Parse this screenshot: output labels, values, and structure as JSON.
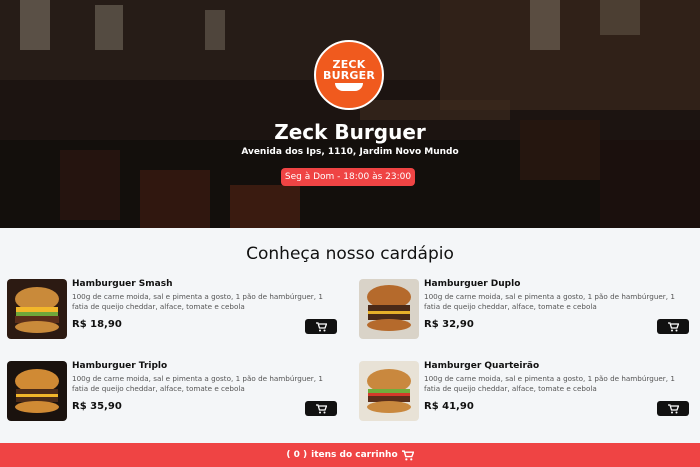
{
  "header": {
    "logo_line1": "ZECK",
    "logo_line2": "BURGER",
    "title": "Zeck Burguer",
    "address": "Avenida dos Ips, 1110, Jardim Novo Mundo",
    "hours": "Seg à Dom - 18:00 às 23:00"
  },
  "menu": {
    "section_title": "Conheça nosso cardápio",
    "items": [
      {
        "name": "Hamburguer Smash",
        "description": "100g de carne moida, sal e pimenta a gosto, 1 pão de hambúrguer, 1 fatia de queijo cheddar, alface, tomate e cebola",
        "price": "R$ 18,90"
      },
      {
        "name": "Hamburguer Duplo",
        "description": "100g de carne moida, sal e pimenta a gosto, 1 pão de hambúrguer, 1 fatia de queijo cheddar, alface, tomate e cebola",
        "price": "R$ 32,90"
      },
      {
        "name": "Hamburguer Triplo",
        "description": "100g de carne moida, sal e pimenta a gosto, 1 pão de hambúrguer, 1 fatia de queijo cheddar, alface, tomate e cebola",
        "price": "R$ 35,90"
      },
      {
        "name": "Hamburger Quarteirão",
        "description": "100g de carne moida, sal e pimenta a gosto, 1 pão de hambúrguer, 1 fatia de queijo cheddar, alface, tomate e cebola",
        "price": "R$ 41,90"
      }
    ],
    "cart_icon": "shopping-cart-icon"
  },
  "footer": {
    "cart_count": "( 0 )",
    "cart_label": "itens do carrinho",
    "icon": "shopping-cart-icon"
  },
  "colors": {
    "accent": "#ef4444",
    "logo_bg": "#f05a1e",
    "button_bg": "#111111"
  }
}
